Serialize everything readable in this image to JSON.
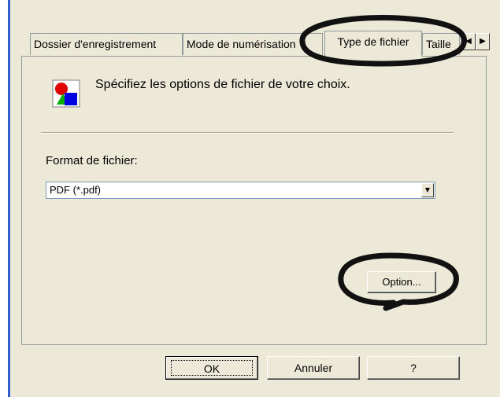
{
  "tabs": [
    {
      "label": "Dossier d'enregistrement"
    },
    {
      "label": "Mode de numérisation"
    },
    {
      "label": "Type de fichier"
    },
    {
      "label": "Taille"
    }
  ],
  "tab_scroll": {
    "left_icon": "arrow-left-icon",
    "right_icon": "arrow-right-icon"
  },
  "header": {
    "icon": "file-type-icon",
    "text": "Spécifiez les options de fichier de votre choix."
  },
  "format": {
    "label": "Format de fichier:",
    "selected": "PDF (*.pdf)"
  },
  "option_button": "Option...",
  "footer": {
    "ok": "OK",
    "cancel": "Annuler",
    "help": "?"
  },
  "colors": {
    "dialog_bg": "#ece9d8",
    "annotation": "#111111",
    "accent": "#2f5fd0"
  }
}
